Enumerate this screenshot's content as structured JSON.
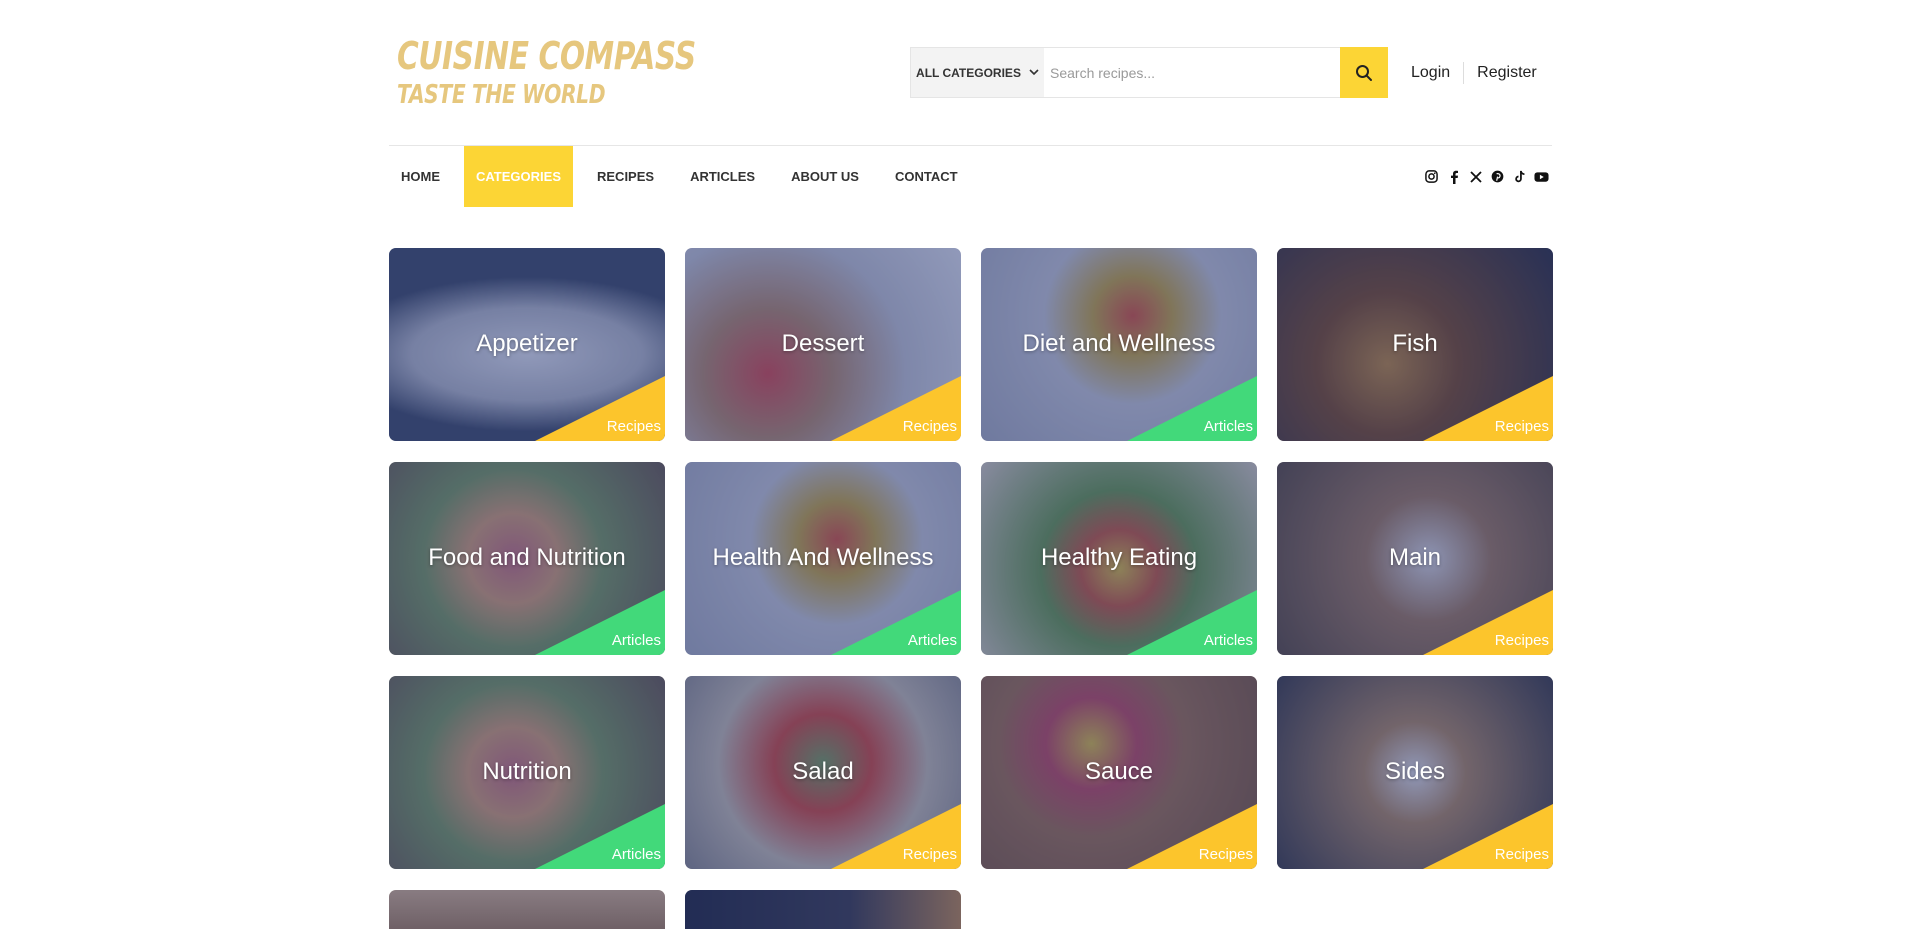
{
  "brand": {
    "title": "Cuisine Compass",
    "tagline": "Taste the World",
    "color": "#e6c77e"
  },
  "search": {
    "category_label": "ALL CATEGORIES",
    "placeholder": "Search recipes...",
    "accent": "#fcd535"
  },
  "auth": {
    "login": "Login",
    "register": "Register"
  },
  "nav": {
    "items": [
      {
        "label": "HOME",
        "active": false
      },
      {
        "label": "CATEGORIES",
        "active": true
      },
      {
        "label": "RECIPES",
        "active": false
      },
      {
        "label": "ARTICLES",
        "active": false
      },
      {
        "label": "ABOUT US",
        "active": false
      },
      {
        "label": "CONTACT",
        "active": false
      }
    ]
  },
  "social": [
    "instagram-icon",
    "facebook-icon",
    "x-icon",
    "pinterest-icon",
    "tiktok-icon",
    "youtube-icon"
  ],
  "colors": {
    "recipes": "#fcc52c",
    "articles": "#42d97a"
  },
  "categories": [
    {
      "name": "Appetizer",
      "type": "Recipes"
    },
    {
      "name": "Dessert",
      "type": "Recipes"
    },
    {
      "name": "Diet and Wellness",
      "type": "Articles"
    },
    {
      "name": "Fish",
      "type": "Recipes"
    },
    {
      "name": "Food and Nutrition",
      "type": "Articles"
    },
    {
      "name": "Health And Wellness",
      "type": "Articles"
    },
    {
      "name": "Healthy Eating",
      "type": "Articles"
    },
    {
      "name": "Main",
      "type": "Recipes"
    },
    {
      "name": "Nutrition",
      "type": "Articles"
    },
    {
      "name": "Salad",
      "type": "Recipes"
    },
    {
      "name": "Sauce",
      "type": "Recipes"
    },
    {
      "name": "Sides",
      "type": "Recipes"
    }
  ]
}
